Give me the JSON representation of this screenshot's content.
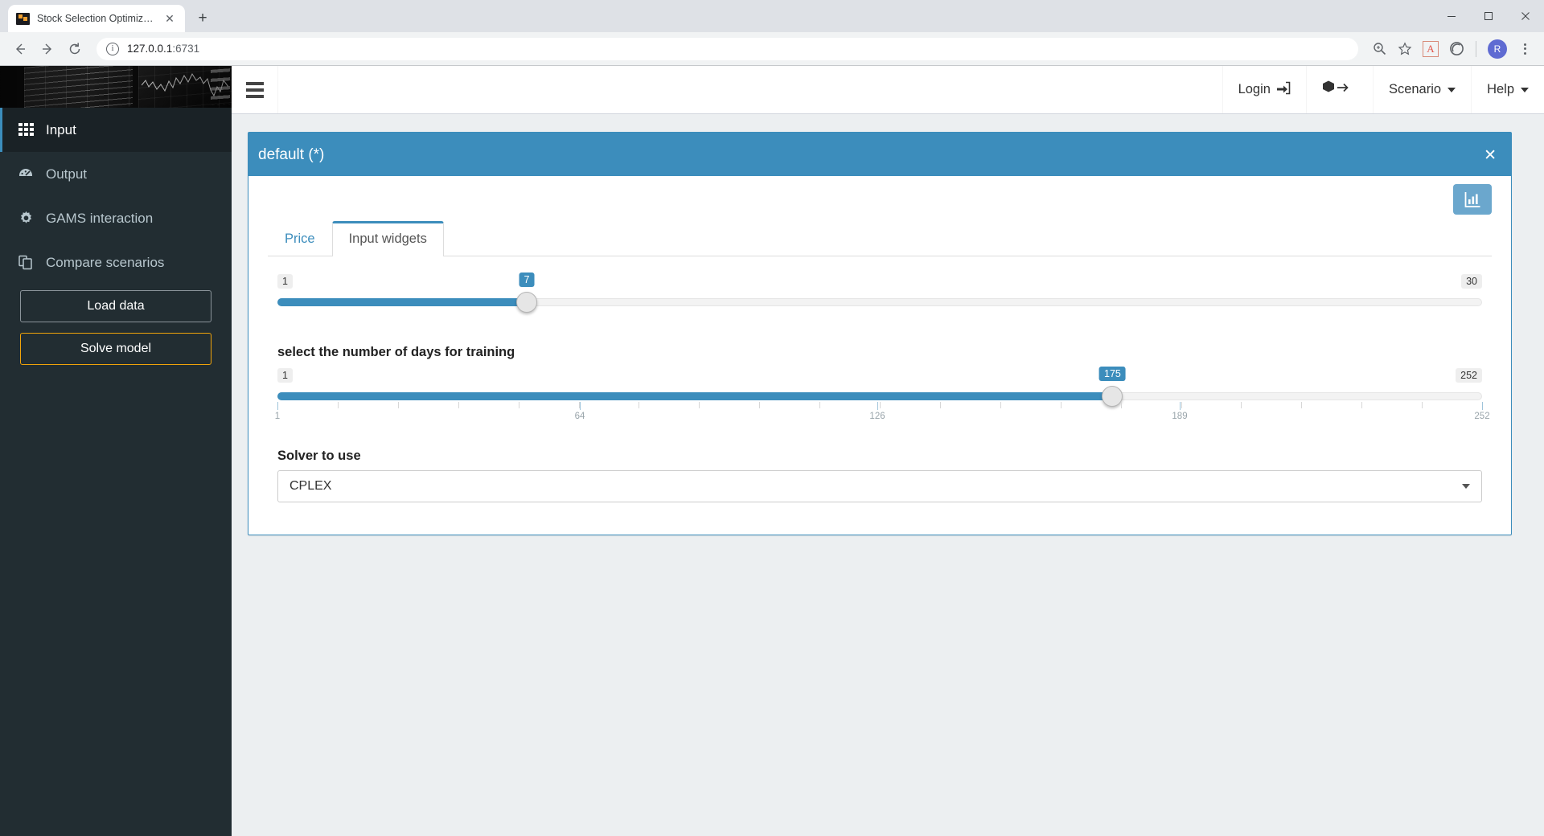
{
  "browser": {
    "tab": {
      "title": "Stock Selection Optimization",
      "favicon": "stock-chart-favicon",
      "close_label": "✕"
    },
    "new_tab_label": "+",
    "window_controls": {
      "minimize": "minimize-icon",
      "maximize": "maximize-icon",
      "close": "close-icon"
    },
    "nav": {
      "back": "back-arrow-icon",
      "forward": "forward-arrow-icon",
      "reload": "reload-icon"
    },
    "omnibox": {
      "info_icon": "site-info-icon",
      "url": "127.0.0.1",
      "port": ":6731"
    },
    "toolbar_icons": {
      "zoom": "zoom-search-icon",
      "bookmark": "star-icon",
      "pdf": "adobe-pdf-extension-icon",
      "pdf_glyph": "A",
      "extension": "extension-circle-icon",
      "profile_initial": "R",
      "menu": "three-dot-menu-icon"
    }
  },
  "sidebar": {
    "header_image": "stock-trading-screens-photo",
    "items": [
      {
        "label": "Input",
        "icon": "grid-icon",
        "active": true
      },
      {
        "label": "Output",
        "icon": "tachometer-icon",
        "active": false
      },
      {
        "label": "GAMS interaction",
        "icon": "gear-icon",
        "active": false
      },
      {
        "label": "Compare scenarios",
        "icon": "copy-icon",
        "active": false
      }
    ],
    "buttons": [
      {
        "label": "Load data",
        "accent": false
      },
      {
        "label": "Solve model",
        "accent": true
      }
    ]
  },
  "navbar": {
    "burger": "hamburger-menu-icon",
    "items": [
      {
        "label": "Login",
        "icon": "sign-in-icon",
        "caret": false
      },
      {
        "label": "",
        "icon": "cube-arrow-icon",
        "caret": false
      },
      {
        "label": "Scenario",
        "icon": "",
        "caret": true
      },
      {
        "label": "Help",
        "icon": "",
        "caret": true
      }
    ]
  },
  "panel": {
    "title": "default (*)",
    "close_label": "✕",
    "chart_button": "bar-chart-icon",
    "tabs": [
      {
        "label": "Price",
        "active": false
      },
      {
        "label": "Input widgets",
        "active": true
      }
    ]
  },
  "widgets": {
    "slider_1": {
      "label": "",
      "min": "1",
      "max": "30",
      "value": "7",
      "min_num": 1,
      "max_num": 30,
      "value_num": 7,
      "ticks": []
    },
    "slider_2": {
      "label": "select the number of days for training",
      "min": "1",
      "max": "252",
      "value": "175",
      "min_num": 1,
      "max_num": 252,
      "value_num": 175,
      "tick_count": 21,
      "tick_labels": [
        "1",
        "64",
        "126",
        "189",
        "252"
      ],
      "tick_label_values": [
        1,
        64,
        126,
        189,
        252
      ]
    },
    "select": {
      "label": "Solver to use",
      "value": "CPLEX",
      "options": [
        "CPLEX"
      ],
      "caret": "chevron-down-icon"
    }
  },
  "colors": {
    "accent_blue": "#3c8dbc",
    "sidebar_bg": "#222d32",
    "accent_orange": "#f0a30a",
    "page_bg": "#eceff1"
  }
}
